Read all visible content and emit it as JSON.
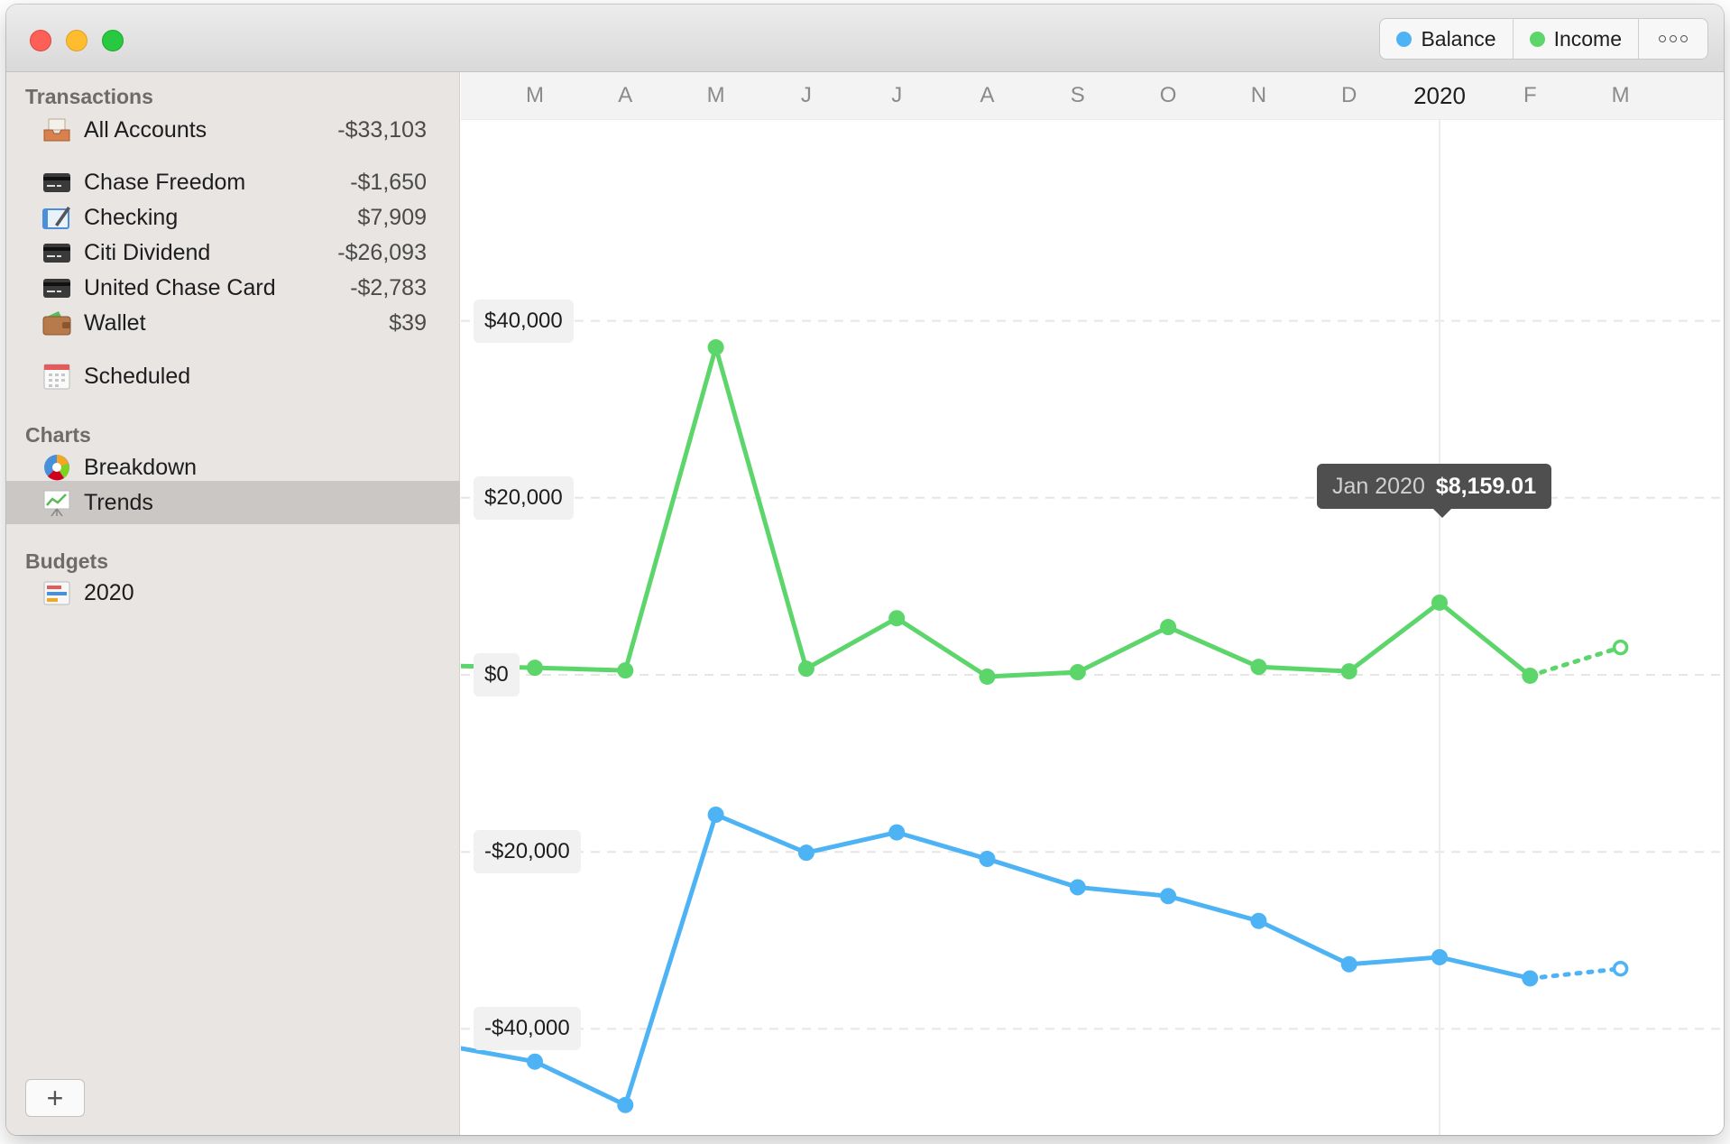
{
  "toolbar": {
    "legend": [
      {
        "label": "Balance",
        "color": "#4db3f5"
      },
      {
        "label": "Income",
        "color": "#5cd56a"
      }
    ],
    "more_icon": "ellipsis-icon"
  },
  "sidebar": {
    "transactions_header": "Transactions",
    "all_accounts": {
      "label": "All Accounts",
      "value": "-$33,103",
      "icon": "inbox-tray-icon"
    },
    "accounts": [
      {
        "label": "Chase Freedom",
        "value": "-$1,650",
        "icon": "credit-card-icon"
      },
      {
        "label": "Checking",
        "value": "$7,909",
        "icon": "checkbook-icon"
      },
      {
        "label": "Citi Dividend",
        "value": "-$26,093",
        "icon": "credit-card-icon"
      },
      {
        "label": "United Chase Card",
        "value": "-$2,783",
        "icon": "credit-card-icon"
      },
      {
        "label": "Wallet",
        "value": "$39",
        "icon": "wallet-icon"
      }
    ],
    "scheduled": {
      "label": "Scheduled",
      "icon": "calendar-icon"
    },
    "charts_header": "Charts",
    "charts": [
      {
        "label": "Breakdown",
        "icon": "pie-chart-icon"
      },
      {
        "label": "Trends",
        "icon": "trend-chart-icon",
        "selected": true
      }
    ],
    "budgets_header": "Budgets",
    "budgets": [
      {
        "label": "2020",
        "icon": "budget-bars-icon"
      }
    ],
    "add_label": "+"
  },
  "chart_data": {
    "type": "line",
    "categories": [
      "M",
      "A",
      "M",
      "J",
      "J",
      "A",
      "S",
      "O",
      "N",
      "D",
      "2020",
      "F",
      "M"
    ],
    "y_ticks": [
      "$40,000",
      "$20,000",
      "$0",
      "-$20,000",
      "-$40,000"
    ],
    "y_tick_values": [
      40000,
      20000,
      0,
      -20000,
      -40000
    ],
    "ylim": [
      -60000,
      55000
    ],
    "grid": true,
    "series": [
      {
        "name": "Income",
        "color": "#5cd56a",
        "values": [
          800,
          500,
          37000,
          700,
          6400,
          -200,
          300,
          5400,
          900,
          400,
          8159.01,
          -100,
          3100
        ],
        "lead_in": 1000,
        "projected_last": true
      },
      {
        "name": "Balance",
        "color": "#4db3f5",
        "values": [
          -43700,
          -48600,
          -15800,
          -20100,
          -17800,
          -20800,
          -24000,
          -25000,
          -27800,
          -32700,
          -31900,
          -34300,
          -33200
        ],
        "lead_in": -42200,
        "projected_last": true
      }
    ],
    "tooltip": {
      "date": "Jan 2020",
      "value": "$8,159.01",
      "index": 10
    }
  }
}
